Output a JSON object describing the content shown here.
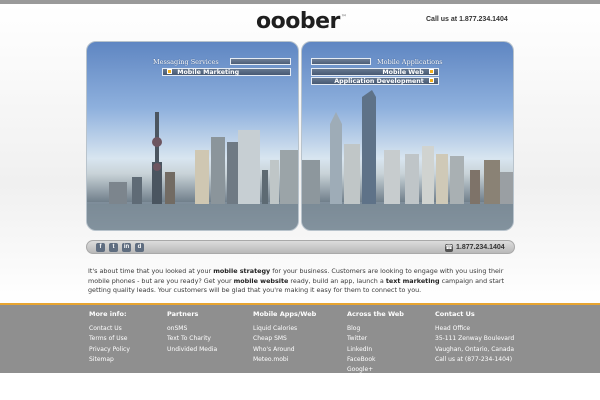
{
  "header": {
    "logo_text": "ooober",
    "logo_tm": "™",
    "call_us": "Call us at 1.877.234.1404"
  },
  "panels": {
    "left": {
      "heading": "Messaging Services",
      "items": [
        "Mobile Marketing"
      ]
    },
    "right": {
      "heading": "Mobile Applications",
      "items": [
        "Mobile Web",
        "Application Development"
      ]
    }
  },
  "social": {
    "icons": [
      "facebook-icon",
      "twitter-icon",
      "linkedin-icon",
      "delicious-icon"
    ],
    "labels": [
      "f",
      "t",
      "in",
      "d"
    ],
    "phone": "1.877.234.1404"
  },
  "intro": {
    "p1": "It's about time that you looked at your ",
    "b1": "mobile strategy",
    "p2": " for your business. Customers are looking to engage with you using their mobile phones - but are you ready? Get your ",
    "b2": "mobile website",
    "p3": " ready, build an app, launch a ",
    "b3": "text marketing",
    "p4": " campaign and start getting quality leads. Your customers will be glad that you're making it easy for them to connect to you."
  },
  "footer": {
    "columns": [
      {
        "heading": "More info:",
        "links": [
          "Contact Us",
          "Terms of Use",
          "Privacy Policy",
          "Sitemap"
        ]
      },
      {
        "heading": "Partners",
        "links": [
          "onSMS",
          "Text To Charity",
          "Undivided Media"
        ]
      },
      {
        "heading": "Mobile Apps/Web",
        "links": [
          "Liquid Calories",
          "Cheap SMS",
          "Who's Around",
          "Meteo.mobi"
        ]
      },
      {
        "heading": "Across the Web",
        "links": [
          "Blog",
          "Twitter",
          "LinkedIn",
          "FaceBook",
          "Google+"
        ]
      },
      {
        "heading": "Contact Us",
        "links": [
          "Head Office",
          "35-111 Zenway Boulevard",
          "Vaughan, Ontario, Canada",
          "Call us at (877-234-1404)"
        ]
      }
    ]
  },
  "colors": {
    "accent": "#f19a1e",
    "footer_bg": "#8f8f8f",
    "footer_rule": "#e8a531",
    "sky_top": "#5f86c2"
  }
}
